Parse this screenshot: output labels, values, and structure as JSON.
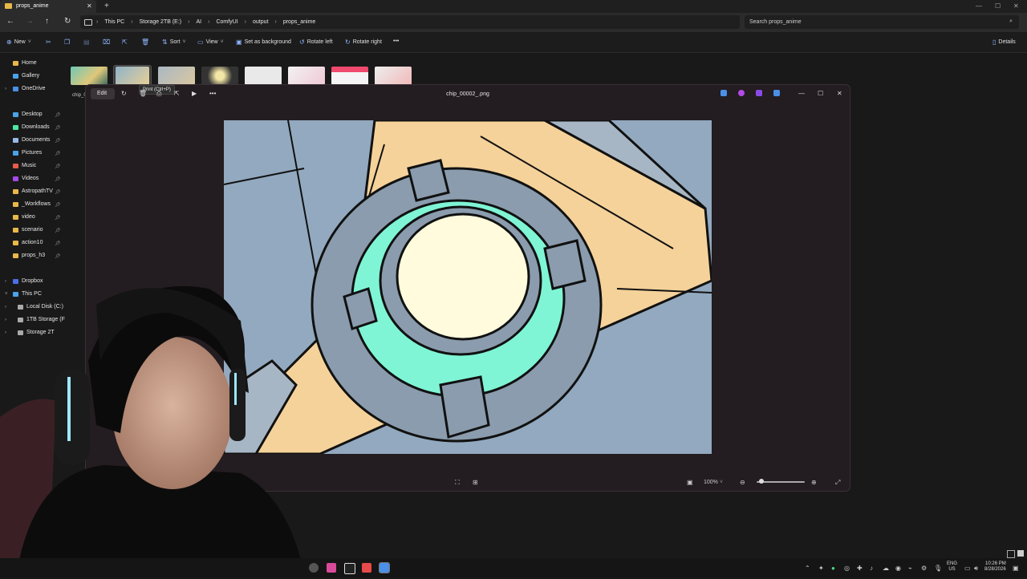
{
  "explorer": {
    "tab_title": "props_anime",
    "new_tab": "+",
    "close": "✕",
    "breadcrumbs": [
      "This PC",
      "Storage 2TB (E:)",
      "AI",
      "ComfyUI",
      "output",
      "props_anime"
    ],
    "search_placeholder": "Search props_anime",
    "commands": {
      "new": "New",
      "sort": "Sort",
      "view": "View",
      "set_background": "Set as background",
      "rotate_left": "Rotate left",
      "rotate_right": "Rotate right",
      "more": "•••",
      "details": "Details"
    },
    "sidebar": [
      {
        "label": "Home",
        "color": "#e8b84a"
      },
      {
        "label": "Gallery",
        "color": "#4aa3e8"
      },
      {
        "label": "OneDrive",
        "color": "#4a8fe8"
      },
      {
        "label": "Desktop",
        "color": "#4aa3e8"
      },
      {
        "label": "Downloads",
        "color": "#4ae8a3"
      },
      {
        "label": "Documents",
        "color": "#9ab8e8"
      },
      {
        "label": "Pictures",
        "color": "#4aa3e8"
      },
      {
        "label": "Music",
        "color": "#e85a4a"
      },
      {
        "label": "Videos",
        "color": "#a34ae8"
      },
      {
        "label": "AstropathTV",
        "color": "#e8b84a"
      },
      {
        "label": "_Workflows",
        "color": "#e8b84a"
      },
      {
        "label": "video",
        "color": "#e8b84a"
      },
      {
        "label": "scenario",
        "color": "#e8b84a"
      },
      {
        "label": "action10",
        "color": "#e8b84a"
      },
      {
        "label": "props_h3",
        "color": "#e8b84a"
      },
      {
        "label": "Dropbox",
        "color": "#4a6fe8"
      },
      {
        "label": "This PC",
        "color": "#4aa3e8"
      },
      {
        "label": "Local Disk (C:)",
        "color": "#aaaaaa"
      },
      {
        "label": "1TB Storage (F",
        "color": "#aaaaaa"
      },
      {
        "label": "Storage 2T",
        "color": "#aaaaaa"
      }
    ],
    "thumb_caption": "chip_0"
  },
  "viewer": {
    "title": "chip_00002_.png",
    "edit_label": "Edit",
    "tooltip": "Print (Ctrl+P)",
    "zoom_label": "100%",
    "minimize": "—",
    "maximize": "☐",
    "close": "✕"
  },
  "taskbar": {
    "lang_top": "ENG",
    "lang_bottom": "US",
    "time": "10:26 PM",
    "date": "8/28/2026"
  },
  "colors": {
    "bg_sky": "#92a9bf",
    "tan": "#f5d29a",
    "slate": "#8a9cad",
    "mint": "#7ff5d5",
    "core": "#fffbdc"
  }
}
